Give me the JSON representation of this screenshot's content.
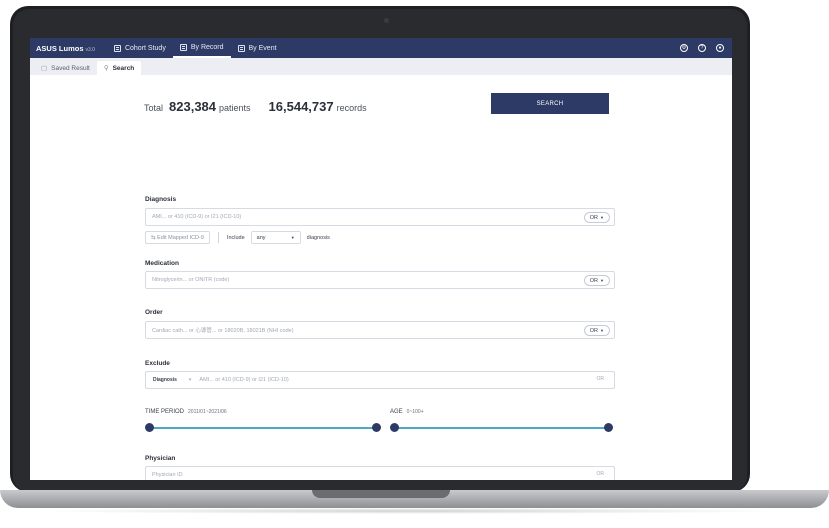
{
  "app": {
    "brand": "ASUS Lumos",
    "version": "v3.0",
    "nav_tabs": [
      {
        "label": "Cohort Study",
        "active": false
      },
      {
        "label": "By Record",
        "active": true
      },
      {
        "label": "By Event",
        "active": false
      }
    ],
    "right_icons": [
      "settings-icon",
      "help-icon",
      "user-icon"
    ]
  },
  "sub_tabs": [
    {
      "label": "Saved Result",
      "active": false
    },
    {
      "label": "Search",
      "active": true
    }
  ],
  "totals": {
    "label": "Total",
    "patients_value": "823,384",
    "patients_unit": "patients",
    "records_value": "16,544,737",
    "records_unit": "records"
  },
  "search_button": "SEARCH",
  "diagnosis": {
    "label": "Diagnosis",
    "placeholder": "AMI... or 410 (ICD-9) or I21 (ICD-10)",
    "logic": "OR",
    "edit_mapped": "Edit Mapped ICD-9",
    "include_label": "Include",
    "include_value": "any",
    "include_suffix": "diagnosis"
  },
  "medication": {
    "label": "Medication",
    "placeholder": "Nitroglycerin... or ONITR (code)",
    "logic": "OR"
  },
  "order": {
    "label": "Order",
    "placeholder": "Cardiac cath... or 心導管... or 18020B, 18021B (NHI code)",
    "logic": "OR"
  },
  "exclude": {
    "label": "Exclude",
    "category": "Diagnosis",
    "placeholder": "AMI... or 410 (ICD-9) or I21 (ICD-10)",
    "logic": "OR"
  },
  "time_period": {
    "label": "TIME PERIOD",
    "value": "2011/01~2021/06",
    "range_fraction": [
      0.0,
      1.0
    ]
  },
  "age": {
    "label": "AGE",
    "value": "0~100+",
    "range_fraction": [
      0.0,
      1.0
    ]
  },
  "physician": {
    "label": "Physician",
    "placeholder": "Physician ID",
    "logic": "OR"
  },
  "colors": {
    "nav": "#2e3a66",
    "accent_track": "#4ba9c7",
    "knob": "#2e3a66"
  }
}
